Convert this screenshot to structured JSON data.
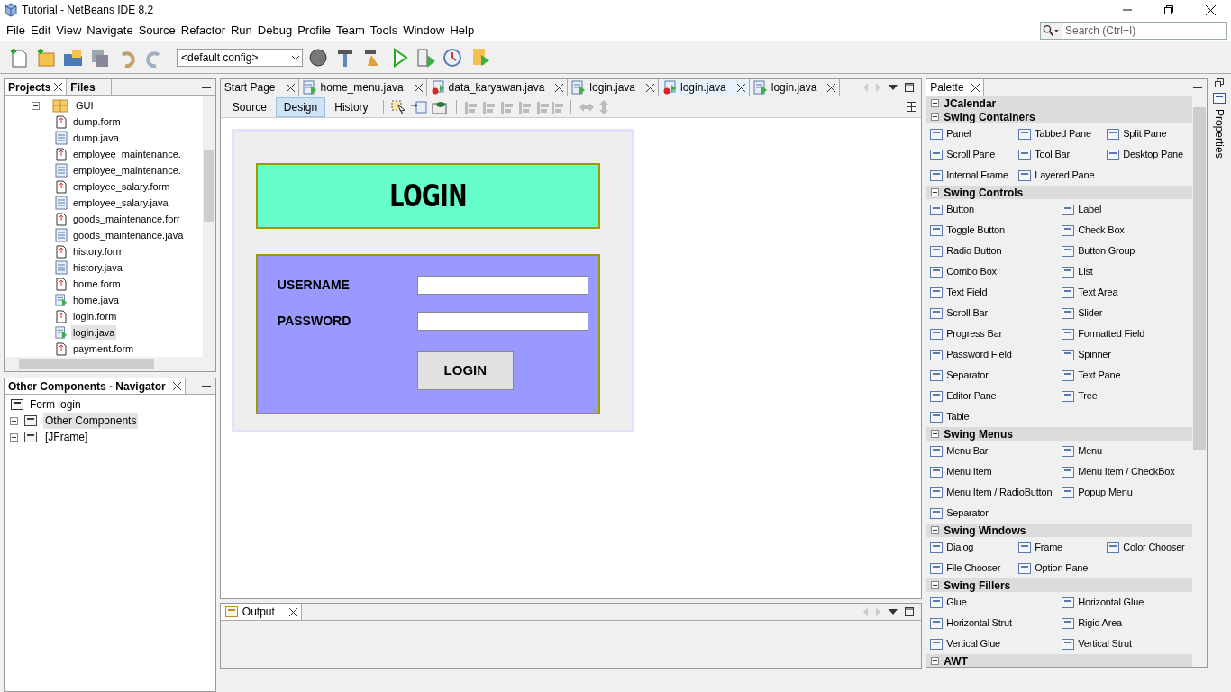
{
  "window": {
    "title": "Tutorial - NetBeans IDE 8.2"
  },
  "menu": [
    "File",
    "Edit",
    "View",
    "Navigate",
    "Source",
    "Refactor",
    "Run",
    "Debug",
    "Profile",
    "Team",
    "Tools",
    "Window",
    "Help"
  ],
  "toolbar": {
    "config": "<default config>"
  },
  "search": {
    "placeholder": "Search (Ctrl+I)"
  },
  "projects": {
    "tabs": [
      {
        "label": "Projects",
        "selected": true
      },
      {
        "label": "Files",
        "selected": false
      }
    ],
    "tree": [
      {
        "label": "GUI",
        "kind": "package",
        "expanded": true,
        "children": [
          {
            "label": "dump.form",
            "kind": "form",
            "selected": false
          },
          {
            "label": "dump.java",
            "kind": "java",
            "selected": false
          },
          {
            "label": "employee_maintenance.",
            "kind": "form",
            "selected": false
          },
          {
            "label": "employee_maintenance.",
            "kind": "java",
            "selected": false
          },
          {
            "label": "employee_salary.form",
            "kind": "form",
            "selected": false
          },
          {
            "label": "employee_salary.java",
            "kind": "java",
            "selected": false
          },
          {
            "label": "goods_maintenance.forr",
            "kind": "form",
            "selected": false
          },
          {
            "label": "goods_maintenance.java",
            "kind": "java",
            "selected": false
          },
          {
            "label": "history.form",
            "kind": "form",
            "selected": false
          },
          {
            "label": "history.java",
            "kind": "java",
            "selected": false
          },
          {
            "label": "home.form",
            "kind": "form",
            "selected": false
          },
          {
            "label": "home.java",
            "kind": "runnable",
            "selected": false
          },
          {
            "label": "login.form",
            "kind": "form",
            "selected": false
          },
          {
            "label": "login.java",
            "kind": "runnable",
            "selected": true
          },
          {
            "label": "payment.form",
            "kind": "form",
            "selected": false
          }
        ]
      }
    ]
  },
  "navigator": {
    "title": "Other Components - Navigator",
    "root": "Form login",
    "children": [
      {
        "label": "Other Components",
        "selected": true
      },
      {
        "label": "[JFrame]",
        "selected": false
      }
    ]
  },
  "editor_tabs": [
    {
      "label": "Start Page",
      "kind": "page",
      "selected": false
    },
    {
      "label": "home_menu.java",
      "kind": "runnable",
      "selected": false
    },
    {
      "label": "data_karyawan.java",
      "kind": "error",
      "selected": false
    },
    {
      "label": "login.java",
      "kind": "runnable",
      "selected": false
    },
    {
      "label": "login.java",
      "kind": "error",
      "selected": true
    },
    {
      "label": "login.java",
      "kind": "runnable",
      "selected": false
    }
  ],
  "view_tabs": [
    {
      "label": "Source",
      "selected": false
    },
    {
      "label": "Design",
      "selected": true
    },
    {
      "label": "History",
      "selected": false
    }
  ],
  "form": {
    "title": "LOGIN",
    "fields": [
      {
        "label": "USERNAME"
      },
      {
        "label": "PASSWORD"
      }
    ],
    "button": "LOGIN"
  },
  "output": {
    "tab": "Output"
  },
  "palette": {
    "title": "Palette",
    "side_tab": "Properties",
    "sections": [
      {
        "title": "JCalendar",
        "expanded": false,
        "kind": "two_column"
      },
      {
        "title": "Swing Containers",
        "expanded": true,
        "kind": "three_column",
        "items": [
          "Panel",
          "Tabbed Pane",
          "Split Pane",
          "Scroll Pane",
          "Tool Bar",
          "Desktop Pane",
          "Internal Frame",
          "Layered Pane"
        ]
      },
      {
        "title": "Swing Controls",
        "expanded": true,
        "kind": "two_column",
        "items": [
          "Button",
          "Label",
          "Toggle Button",
          "Check Box",
          "Radio Button",
          "Button Group",
          "Combo Box",
          "List",
          "Text Field",
          "Text Area",
          "Scroll Bar",
          "Slider",
          "Progress Bar",
          "Formatted Field",
          "Password Field",
          "Spinner",
          "Separator",
          "Text Pane",
          "Editor Pane",
          "Tree",
          "Table"
        ]
      },
      {
        "title": "Swing Menus",
        "expanded": true,
        "kind": "two_column",
        "items": [
          "Menu Bar",
          "Menu",
          "Menu Item",
          "Menu Item / CheckBox",
          "Menu Item / RadioButton",
          "Popup Menu",
          "Separator"
        ]
      },
      {
        "title": "Swing Windows",
        "expanded": true,
        "kind": "three_column",
        "items": [
          "Dialog",
          "Frame",
          "Color Chooser",
          "File Chooser",
          "Option Pane"
        ]
      },
      {
        "title": "Swing Fillers",
        "expanded": true,
        "kind": "two_column",
        "items": [
          "Glue",
          "Horizontal Glue",
          "Horizontal Strut",
          "Rigid Area",
          "Vertical Glue",
          "Vertical Strut"
        ]
      },
      {
        "title": "AWT",
        "expanded": true,
        "kind": "two_column"
      }
    ]
  }
}
